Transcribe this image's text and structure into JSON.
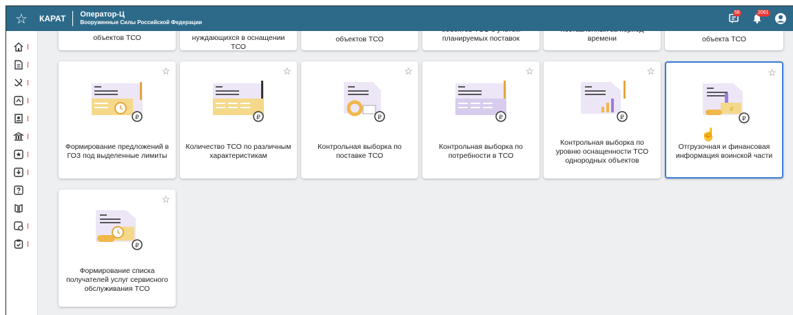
{
  "header": {
    "app_name": "КАРАТ",
    "operator_title": "Оператор-Ц",
    "operator_org": "Вооруженные Силы Российской Федерации",
    "messages_badge": "56",
    "notifications_badge": "2061",
    "accent_color": "#2d6a8a"
  },
  "sidebar": {
    "items": [
      {
        "icon": "home-icon"
      },
      {
        "icon": "document-icon"
      },
      {
        "icon": "wrench-icon"
      },
      {
        "icon": "chat-icon"
      },
      {
        "icon": "user-doc-icon"
      },
      {
        "icon": "bank-icon"
      },
      {
        "icon": "star-box-icon"
      },
      {
        "icon": "download-icon"
      },
      {
        "icon": "help-icon"
      },
      {
        "icon": "book-icon"
      },
      {
        "icon": "settings-doc-icon"
      },
      {
        "icon": "clipboard-icon"
      }
    ]
  },
  "top_row": [
    "объектов ТСО",
    "нуждающихся в оснащении ТСО",
    "объектов ТСО",
    "объектов ТСО с учетом планируемых поставок",
    "поставленных за период времени",
    "объекта ТСО"
  ],
  "cards": [
    {
      "title": "Формирование предложений в ГОЗ под выделенные лимиты"
    },
    {
      "title": "Количество ТСО по различным характеристикам"
    },
    {
      "title": "Контрольная выборка по поставке ТСО"
    },
    {
      "title": "Контрольная выборка по потребности в ТСО"
    },
    {
      "title": "Контрольная выборка по уровню оснащенности ТСО однородных объектов"
    },
    {
      "title": "Отгрузочная и финансовая информация воинской части"
    },
    {
      "title": "Формирование списка получателей услуг сервисного обслуживания ТСО"
    }
  ]
}
